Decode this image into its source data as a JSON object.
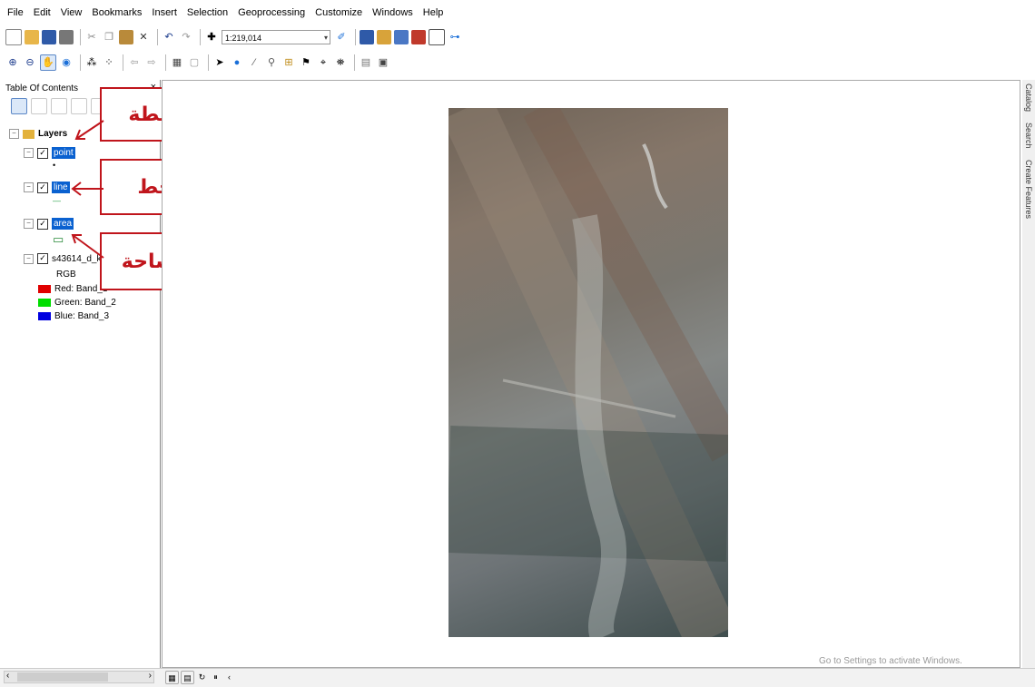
{
  "menu": [
    "File",
    "Edit",
    "View",
    "Bookmarks",
    "Insert",
    "Selection",
    "Geoprocessing",
    "Customize",
    "Windows",
    "Help"
  ],
  "toolbar": {
    "scale": "1:219,014"
  },
  "toc": {
    "title": "Table Of Contents",
    "close": "×",
    "layers_label": "Layers",
    "layers": [
      {
        "name": "point",
        "symbol": "•"
      },
      {
        "name": "line",
        "symbol": "—"
      },
      {
        "name": "area",
        "symbol": "▭"
      }
    ],
    "raster": {
      "name": "s43614_d_k",
      "rgb_label": "RGB",
      "bands": [
        {
          "label": "Red:",
          "band": "Band_1",
          "color": "#e00000"
        },
        {
          "label": "Green:",
          "band": "Band_2",
          "color": "#00dd00"
        },
        {
          "label": "Blue:",
          "band": "Band_3",
          "color": "#0000e0"
        }
      ]
    }
  },
  "callouts": {
    "point": "النقطة",
    "line": "الخط",
    "area": "المساحة"
  },
  "right_dock": [
    "Catalog",
    "Search",
    "Create Features"
  ],
  "watermark": "Go to Settings to activate Windows.",
  "colors": {
    "callout": "#c0151c",
    "selection": "#0a61d0"
  }
}
